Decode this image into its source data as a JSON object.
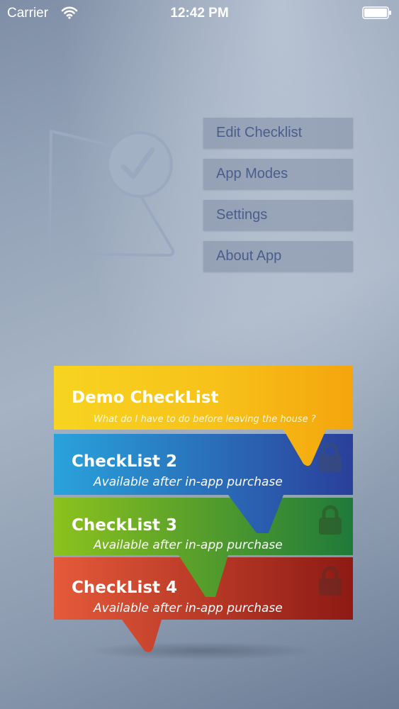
{
  "status_bar": {
    "carrier": "Carrier",
    "time": "12:42 PM",
    "icons": [
      "wifi-icon",
      "battery-icon"
    ]
  },
  "logo": {
    "icon": "checklist-logo-icon"
  },
  "menu": {
    "items": [
      {
        "label": "Edit Checklist"
      },
      {
        "label": "App Modes"
      },
      {
        "label": "Settings"
      },
      {
        "label": "About App"
      }
    ]
  },
  "checklists": [
    {
      "title": "Demo CheckList",
      "subtitle": "What do I have to do before leaving the house ?",
      "locked": false,
      "colors": [
        "#f7d420",
        "#f4a50c"
      ]
    },
    {
      "title": "CheckList 2",
      "subtitle": "Available after in-app purchase",
      "locked": true,
      "colors": [
        "#29a3dc",
        "#2a3f9a"
      ]
    },
    {
      "title": "CheckList 3",
      "subtitle": "Available after in-app purchase",
      "locked": true,
      "colors": [
        "#8cc21e",
        "#1f7a3a"
      ]
    },
    {
      "title": "CheckList 4",
      "subtitle": "Available after in-app purchase",
      "locked": true,
      "colors": [
        "#e55a3a",
        "#8d1a14"
      ]
    }
  ]
}
